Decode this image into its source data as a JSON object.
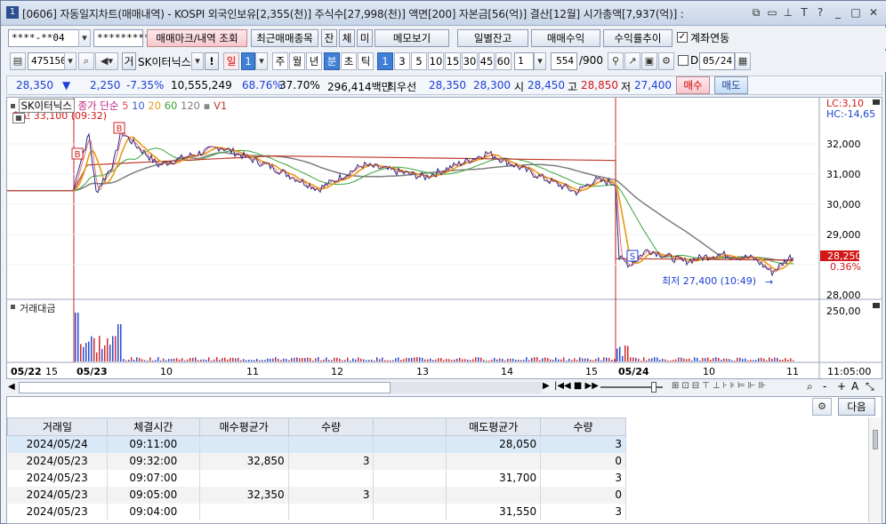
{
  "title": {
    "num": "1",
    "text": "[0606] 자동일지차트(매매내역) - KOSPI 외국인보유[2,355(천)] 주식수[27,998(천)] 액면[200] 자본금[56(억)] 결산[12월] 시가총액[7,937(억)] :"
  },
  "toolbar1": {
    "account": "****-**04",
    "password": "*********",
    "mark_btn": "매매마크/내역 조회",
    "recent_btn": "최근매매종목",
    "jan_btn": "잔",
    "che_btn": "체",
    "mi_btn": "미",
    "memo_btn": "메모보기",
    "daily_btn": "일별잔고",
    "trade_profit_btn": "매매수익",
    "return_btn": "수익률추이",
    "link_label": "계좌연동"
  },
  "toolbar2": {
    "code": "475150",
    "geo": "거",
    "stock_name": "SK이터닉스",
    "excl": "!",
    "period_il": "일",
    "period_num": "1",
    "ju": "주",
    "wol": "월",
    "nyeon": "년",
    "bun": "분",
    "cho": "초",
    "tik": "틱",
    "minutes": [
      "1",
      "3",
      "5",
      "10",
      "15",
      "30",
      "45",
      "60"
    ],
    "count_sel": "1",
    "count": "554",
    "count_max": "/900",
    "d_label": "D",
    "date": "05/24"
  },
  "quote": {
    "price": "28,350",
    "change": "2,250",
    "rate": "-7.35%",
    "volume": "10,555,249",
    "turnover1": "68.76%",
    "turnover2": "37.70%",
    "amount": "296,414백만",
    "best_label": "최우선",
    "ask": "28,350",
    "bid": "28,300",
    "open_label": "시",
    "open": "28,450",
    "high_label": "고",
    "high": "28,850",
    "low_label": "저",
    "low": "27,400",
    "buy_btn": "매수",
    "sell_btn": "매도"
  },
  "chart": {
    "legend_name": "SK이터닉스",
    "legend_type": "종가 단순",
    "ma": [
      "5",
      "10",
      "20",
      "60",
      "120"
    ],
    "v1": "V1",
    "max_label": "최고 33,100 (09:32)",
    "min_label": "최저 27,400 (10:49)",
    "lc": "LC:3,10",
    "hc": "HC:-14,65",
    "price_tag": "28,250",
    "pct_tag": "0.36%",
    "yticks": [
      "32,000",
      "31,000",
      "30,000",
      "29,000",
      "28,000"
    ],
    "vol_title": "거래대금",
    "vol_tick": "250,00",
    "xlabels": [
      "05/22",
      "15",
      "05/23",
      "10",
      "11",
      "12",
      "13",
      "14",
      "15",
      "05/24",
      "10",
      "11"
    ],
    "time_right": "11:05:00",
    "marks": [
      "B",
      "B",
      "S"
    ],
    "colors": {
      "ma5": "#e05050",
      "ma10": "#3b5ec7",
      "ma20": "#e69b16",
      "ma60": "#3aa33a",
      "ma120": "#7d7d7d",
      "v1": "#c0392b"
    }
  },
  "chart_data": {
    "type": "line",
    "title": "",
    "xlabel": "",
    "ylabel": "",
    "ylim": [
      27100,
      33300
    ],
    "x": [
      "05/22 15:20",
      "05/23 09:00",
      "05/23 09:32",
      "05/23 10:00",
      "05/23 11:00",
      "05/23 12:00",
      "05/23 13:00",
      "05/23 14:00",
      "05/23 15:00",
      "05/23 15:20",
      "05/24 09:01",
      "05/24 09:30",
      "05/24 10:00",
      "05/24 10:49",
      "05/24 11:05"
    ],
    "series": [
      {
        "name": "SK이터닉스",
        "values": [
          30450,
          30800,
          33100,
          31500,
          31900,
          30900,
          31050,
          31200,
          30600,
          30800,
          28200,
          28500,
          28300,
          27400,
          28250
        ]
      }
    ]
  },
  "scroll": {
    "zoom_icons": [
      "|◀◀",
      "■",
      "▶▶"
    ],
    "right_icons": [
      "-",
      "+",
      "A"
    ]
  },
  "table": {
    "btn_next": "다음",
    "headers": [
      "거래일",
      "체결시간",
      "매수평균가",
      "수량",
      "",
      "매도평균가",
      "수량"
    ],
    "rows": [
      [
        "2024/05/24",
        "09:11:00",
        "",
        "",
        "",
        "28,050",
        "3"
      ],
      [
        "2024/05/23",
        "09:32:00",
        "32,850",
        "3",
        "",
        "",
        "0"
      ],
      [
        "2024/05/23",
        "09:07:00",
        "",
        "",
        "",
        "31,700",
        "3"
      ],
      [
        "2024/05/23",
        "09:05:00",
        "32,350",
        "3",
        "",
        "",
        "0"
      ],
      [
        "2024/05/23",
        "09:04:00",
        "",
        "",
        "",
        "31,550",
        "3"
      ]
    ]
  }
}
